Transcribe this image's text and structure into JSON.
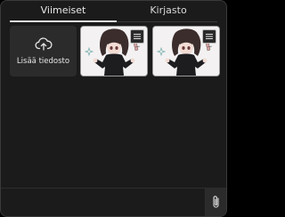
{
  "tabs": [
    {
      "label": "Viimeiset",
      "active": true
    },
    {
      "label": "Kirjasto",
      "active": false
    }
  ],
  "upload_tile": {
    "label": "Lisää tiedosto",
    "icon": "cloud-upload-icon"
  },
  "recent_images": [
    {
      "alt": "image-thumbnail",
      "menu_icon": "menu-icon"
    },
    {
      "alt": "image-thumbnail",
      "menu_icon": "menu-icon"
    }
  ],
  "bottom_bar": {
    "attach_icon": "paperclip-icon"
  },
  "colors": {
    "panel_background": "#1b1b1b",
    "tile_background": "#2b2b2b",
    "active_tab_indicator": "#dcdcdc",
    "text": "#e8e8e8"
  }
}
